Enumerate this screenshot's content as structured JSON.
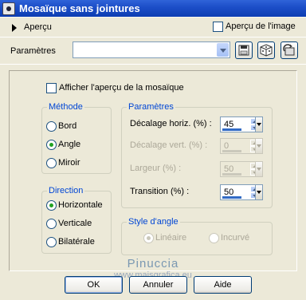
{
  "window": {
    "title": "Mosaïque sans jointures"
  },
  "preview": {
    "label": "Aperçu",
    "image_preview_label": "Aperçu de l'image",
    "image_preview_checked": false
  },
  "presets": {
    "label": "Paramètres",
    "value": ""
  },
  "mosaic_preview": {
    "label": "Afficher l'aperçu de la mosaïque",
    "checked": false
  },
  "method": {
    "title": "Méthode",
    "options": [
      "Bord",
      "Angle",
      "Miroir"
    ],
    "selected": "Angle"
  },
  "direction": {
    "title": "Direction",
    "options": [
      "Horizontale",
      "Verticale",
      "Bilatérale"
    ],
    "selected": "Horizontale"
  },
  "parameters": {
    "title": "Paramètres",
    "horiz_offset": {
      "label": "Décalage horiz. (%) :",
      "value": "45",
      "enabled": true
    },
    "vert_offset": {
      "label": "Décalage vert. (%) :",
      "value": "0",
      "enabled": false
    },
    "width": {
      "label": "Largeur (%) :",
      "value": "50",
      "enabled": false
    },
    "transition": {
      "label": "Transition (%) :",
      "value": "50",
      "enabled": true
    }
  },
  "corner_style": {
    "title": "Style d'angle",
    "options": [
      "Linéaire",
      "Incurvé"
    ],
    "selected": "Linéaire",
    "enabled": false
  },
  "watermark": {
    "name": "Pinuccia",
    "url": "www.maisgrafica.eu"
  },
  "buttons": {
    "ok": "OK",
    "cancel": "Annuler",
    "help": "Aide"
  },
  "colors": {
    "title_bar": "#1d4fc9",
    "group_title": "#0046d5",
    "face": "#ece9d8"
  }
}
